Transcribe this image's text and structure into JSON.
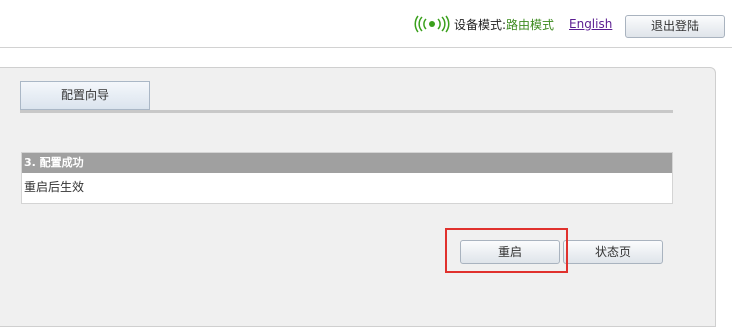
{
  "header": {
    "device_mode_label": "设备模式:",
    "device_mode_value": "路由模式",
    "language_link": "English",
    "logout_label": "退出登陆",
    "mode_icon": "wifi-signal-icon",
    "mode_icon_color": "#3aa01c"
  },
  "wizard": {
    "tab_label": "配置向导",
    "step_title": "3. 配置成功",
    "step_message": "重启后生效",
    "restart_label": "重启",
    "status_page_label": "状态页"
  },
  "colors": {
    "section_header_bg": "#a0a0a0",
    "panel_bg": "#f0f0f0",
    "highlight": "#e0312d",
    "mode_value": "#3c8a1e",
    "link": "#5b1d91"
  }
}
